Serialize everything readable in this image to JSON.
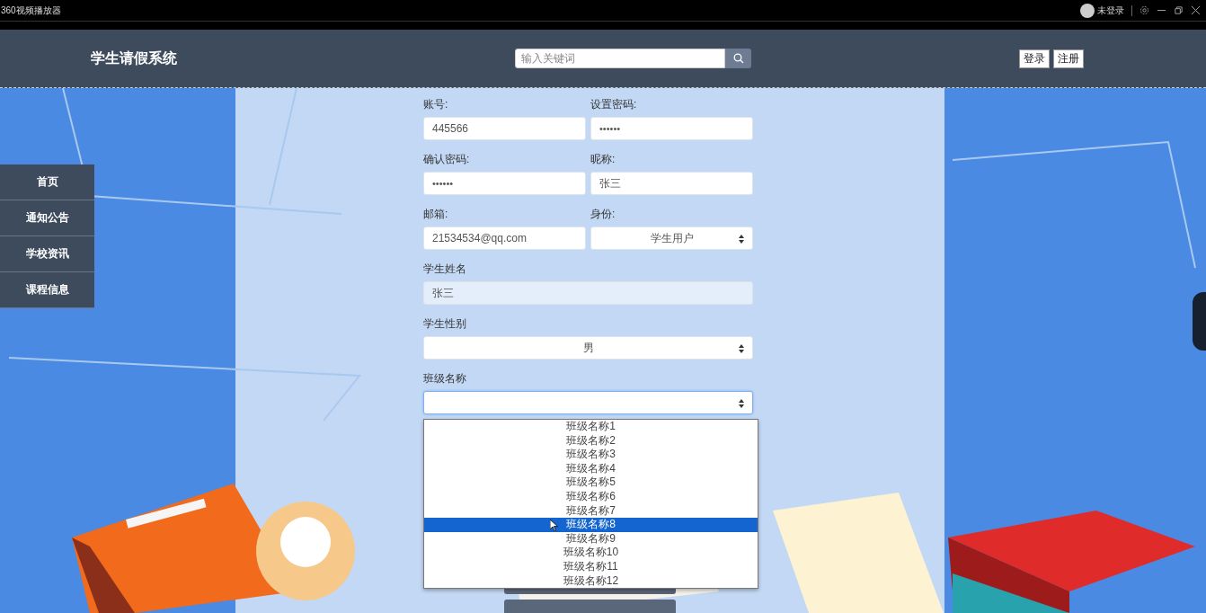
{
  "window": {
    "title": "360视频播放器",
    "user": "未登录"
  },
  "header": {
    "title": "学生请假系统",
    "search": {
      "placeholder": "输入关键词"
    },
    "buttons": [
      "登录",
      "注册"
    ]
  },
  "nav": [
    {
      "label": "首页"
    },
    {
      "label": "通知公告"
    },
    {
      "label": "学校资讯"
    },
    {
      "label": "课程信息"
    }
  ],
  "form": {
    "fields": [
      {
        "label": "账号:",
        "kind": "text",
        "wide": false,
        "disabled": false,
        "focused": false,
        "value": "445566"
      },
      {
        "label": "设置密码:",
        "kind": "password",
        "wide": false,
        "disabled": false,
        "focused": false,
        "value": "••••••"
      },
      {
        "label": "确认密码:",
        "kind": "password",
        "wide": false,
        "disabled": false,
        "focused": false,
        "value": "••••••"
      },
      {
        "label": "昵称:",
        "kind": "text",
        "wide": false,
        "disabled": false,
        "focused": false,
        "value": "张三"
      },
      {
        "label": "邮箱:",
        "kind": "text",
        "wide": false,
        "disabled": false,
        "focused": false,
        "value": "21534534@qq.com"
      },
      {
        "label": "身份:",
        "kind": "select",
        "wide": false,
        "disabled": false,
        "focused": false,
        "value": "学生用户"
      },
      {
        "label": "学生姓名",
        "kind": "text",
        "wide": true,
        "disabled": true,
        "focused": false,
        "value": "张三"
      },
      {
        "label": "学生性别",
        "kind": "select",
        "wide": true,
        "disabled": false,
        "focused": false,
        "value": "男"
      },
      {
        "label": "班级名称",
        "kind": "select",
        "wide": true,
        "disabled": false,
        "focused": true
      }
    ],
    "options": [
      {
        "label": "班级名称1",
        "selected": false
      },
      {
        "label": "班级名称2",
        "selected": false
      },
      {
        "label": "班级名称3",
        "selected": false
      },
      {
        "label": "班级名称4",
        "selected": false
      },
      {
        "label": "班级名称5",
        "selected": false
      },
      {
        "label": "班级名称6",
        "selected": false
      },
      {
        "label": "班级名称7",
        "selected": false
      },
      {
        "label": "班级名称8",
        "selected": true
      },
      {
        "label": "班级名称9",
        "selected": false
      },
      {
        "label": "班级名称10",
        "selected": false
      },
      {
        "label": "班级名称11",
        "selected": false
      },
      {
        "label": "班级名称12",
        "selected": false
      }
    ]
  }
}
